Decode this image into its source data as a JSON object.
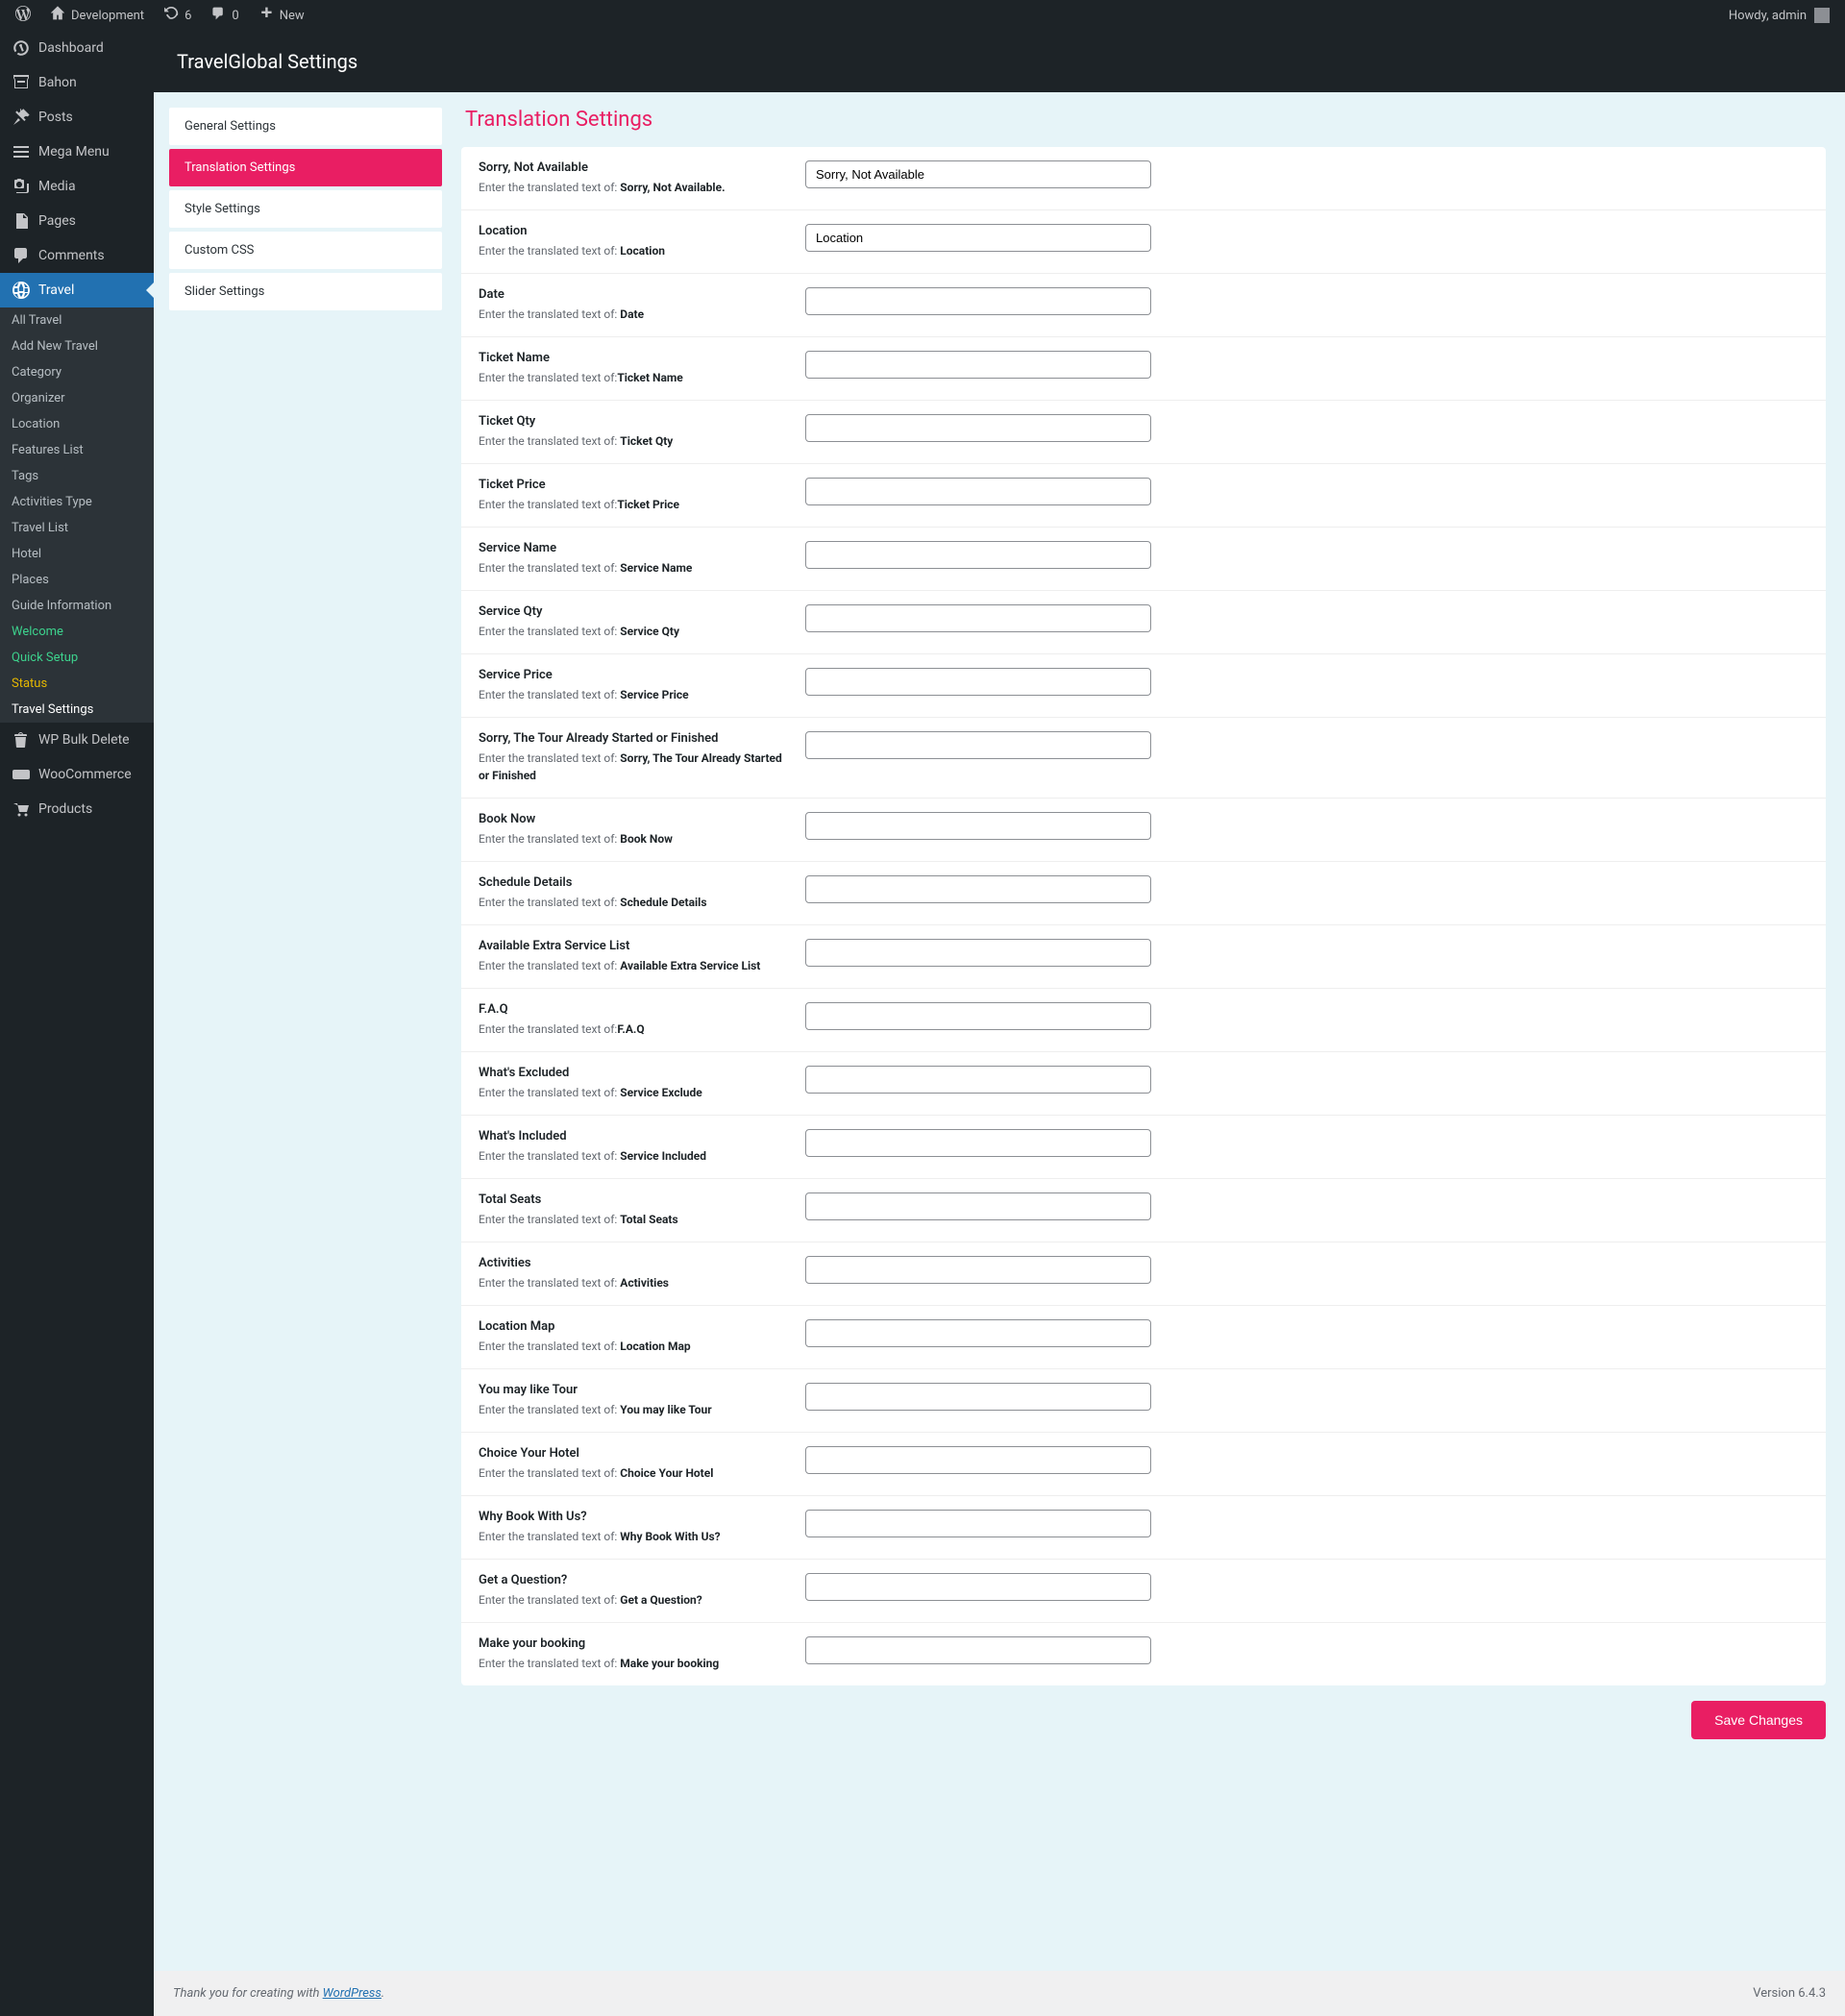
{
  "adminBar": {
    "siteName": "Development",
    "updatesCount": "6",
    "commentsCount": "0",
    "newLabel": "New",
    "howdy": "Howdy, admin"
  },
  "sidebar": {
    "items": [
      {
        "label": "Dashboard",
        "icon": "dashboard"
      },
      {
        "label": "Bahon",
        "icon": "store"
      },
      {
        "label": "Posts",
        "icon": "pin"
      },
      {
        "label": "Mega Menu",
        "icon": "menu"
      },
      {
        "label": "Media",
        "icon": "media"
      },
      {
        "label": "Pages",
        "icon": "pages"
      },
      {
        "label": "Comments",
        "icon": "comments"
      },
      {
        "label": "Travel",
        "icon": "globe",
        "active": true
      },
      {
        "label": "WP Bulk Delete",
        "icon": "trash"
      },
      {
        "label": "WooCommerce",
        "icon": "woo"
      },
      {
        "label": "Products",
        "icon": "products"
      }
    ],
    "submenu": [
      {
        "label": "All Travel"
      },
      {
        "label": "Add New Travel"
      },
      {
        "label": "Category"
      },
      {
        "label": "Organizer"
      },
      {
        "label": "Location"
      },
      {
        "label": "Features List"
      },
      {
        "label": "Tags"
      },
      {
        "label": "Activities Type"
      },
      {
        "label": "Travel List"
      },
      {
        "label": "Hotel"
      },
      {
        "label": "Places"
      },
      {
        "label": "Guide Information"
      },
      {
        "label": "Welcome",
        "variant": "green"
      },
      {
        "label": "Quick Setup",
        "variant": "green"
      },
      {
        "label": "Status",
        "variant": "yellow"
      },
      {
        "label": "Travel Settings",
        "variant": "white"
      }
    ]
  },
  "page": {
    "header": "TravelGlobal Settings",
    "panelTitle": "Translation Settings",
    "saveLabel": "Save Changes"
  },
  "tabs": [
    {
      "label": "General Settings"
    },
    {
      "label": "Translation Settings",
      "active": true
    },
    {
      "label": "Style Settings"
    },
    {
      "label": "Custom CSS"
    },
    {
      "label": "Slider Settings"
    }
  ],
  "fields": [
    {
      "title": "Sorry, Not Available",
      "descPrefix": "Enter the translated text of: ",
      "descBold": "Sorry, Not Available.",
      "value": "Sorry, Not Available"
    },
    {
      "title": "Location",
      "descPrefix": "Enter the translated text of: ",
      "descBold": "Location",
      "value": "Location"
    },
    {
      "title": "Date",
      "descPrefix": "Enter the translated text of: ",
      "descBold": "Date",
      "value": ""
    },
    {
      "title": "Ticket Name",
      "descPrefix": "Enter the translated text of:",
      "descBold": "Ticket Name",
      "value": ""
    },
    {
      "title": "Ticket Qty",
      "descPrefix": "Enter the translated text of: ",
      "descBold": "Ticket Qty",
      "value": ""
    },
    {
      "title": "Ticket Price",
      "descPrefix": "Enter the translated text of:",
      "descBold": "Ticket Price",
      "value": ""
    },
    {
      "title": "Service Name",
      "descPrefix": "Enter the translated text of: ",
      "descBold": "Service Name",
      "value": ""
    },
    {
      "title": "Service Qty",
      "descPrefix": "Enter the translated text of: ",
      "descBold": "Service Qty",
      "value": ""
    },
    {
      "title": "Service Price",
      "descPrefix": "Enter the translated text of: ",
      "descBold": "Service Price",
      "value": ""
    },
    {
      "title": "Sorry, The Tour Already Started or Finished",
      "descPrefix": "Enter the translated text of: ",
      "descBold": "Sorry, The Tour Already Started or Finished",
      "value": ""
    },
    {
      "title": "Book Now",
      "descPrefix": "Enter the translated text of: ",
      "descBold": "Book Now",
      "value": ""
    },
    {
      "title": "Schedule Details",
      "descPrefix": "Enter the translated text of: ",
      "descBold": "Schedule Details",
      "value": ""
    },
    {
      "title": "Available Extra Service List",
      "descPrefix": "Enter the translated text of: ",
      "descBold": "Available Extra Service List",
      "value": ""
    },
    {
      "title": "F.A.Q",
      "descPrefix": "Enter the translated text of:",
      "descBold": "F.A.Q",
      "value": ""
    },
    {
      "title": "What's Excluded",
      "descPrefix": "Enter the translated text of: ",
      "descBold": "Service Exclude",
      "value": ""
    },
    {
      "title": "What's Included",
      "descPrefix": "Enter the translated text of: ",
      "descBold": "Service Included",
      "value": ""
    },
    {
      "title": "Total Seats",
      "descPrefix": "Enter the translated text of: ",
      "descBold": "Total Seats",
      "value": ""
    },
    {
      "title": "Activities",
      "descPrefix": "Enter the translated text of: ",
      "descBold": "Activities",
      "value": ""
    },
    {
      "title": "Location Map",
      "descPrefix": "Enter the translated text of: ",
      "descBold": "Location Map",
      "value": ""
    },
    {
      "title": "You may like Tour",
      "descPrefix": "Enter the translated text of: ",
      "descBold": "You may like Tour",
      "value": ""
    },
    {
      "title": "Choice Your Hotel",
      "descPrefix": "Enter the translated text of: ",
      "descBold": "Choice Your Hotel",
      "value": ""
    },
    {
      "title": "Why Book With Us?",
      "descPrefix": "Enter the translated text of: ",
      "descBold": "Why Book With Us?",
      "value": ""
    },
    {
      "title": "Get a Question?",
      "descPrefix": "Enter the translated text of: ",
      "descBold": "Get a Question?",
      "value": ""
    },
    {
      "title": "Make your booking",
      "descPrefix": "Enter the translated text of: ",
      "descBold": "Make your booking",
      "value": ""
    }
  ],
  "footer": {
    "thankYouPrefix": "Thank you for creating with ",
    "wpLink": "WordPress",
    "thankYouSuffix": ".",
    "version": "Version 6.4.3"
  }
}
